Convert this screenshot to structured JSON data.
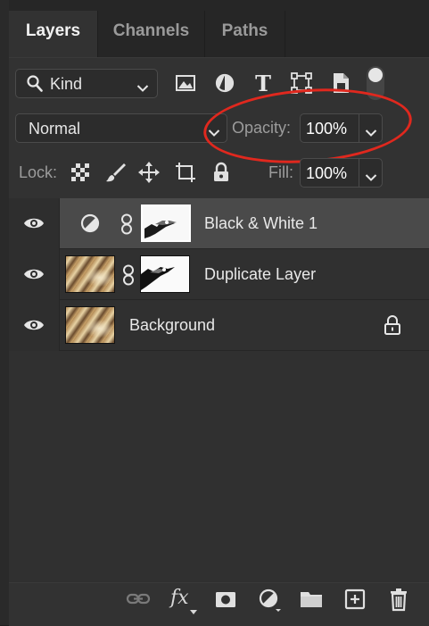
{
  "tabs": [
    {
      "label": "Layers",
      "active": true
    },
    {
      "label": "Channels",
      "active": false
    },
    {
      "label": "Paths",
      "active": false
    }
  ],
  "filter": {
    "kind_label": "Kind",
    "filter_icons": [
      "image-filter-icon",
      "adjustment-filter-icon",
      "type-filter-icon",
      "shape-filter-icon",
      "smart-object-filter-icon"
    ],
    "filter_toggle_on": true
  },
  "blend": {
    "mode": "Normal",
    "opacity_label": "Opacity:",
    "opacity_value": "100%"
  },
  "lock": {
    "label": "Lock:",
    "fill_label": "Fill:",
    "fill_value": "100%"
  },
  "layers": [
    {
      "name": "Black & White 1",
      "type": "adjustment",
      "visible": true,
      "selected": true,
      "has_mask": true,
      "locked": false
    },
    {
      "name": "Duplicate Layer",
      "type": "pixel",
      "visible": true,
      "selected": false,
      "has_mask": true,
      "locked": false
    },
    {
      "name": "Background",
      "type": "pixel",
      "visible": true,
      "selected": false,
      "has_mask": false,
      "locked": true
    }
  ],
  "bottom_toolbar": {
    "fx_label": "fx",
    "icons": [
      "link-layers-icon",
      "fx-icon",
      "add-mask-icon",
      "adjustment-layer-icon",
      "new-group-icon",
      "new-layer-icon",
      "delete-layer-icon"
    ]
  },
  "colors": {
    "panel_bg": "#323232",
    "selected_row": "#4a4a4a",
    "annotation_red": "#e0281e"
  }
}
